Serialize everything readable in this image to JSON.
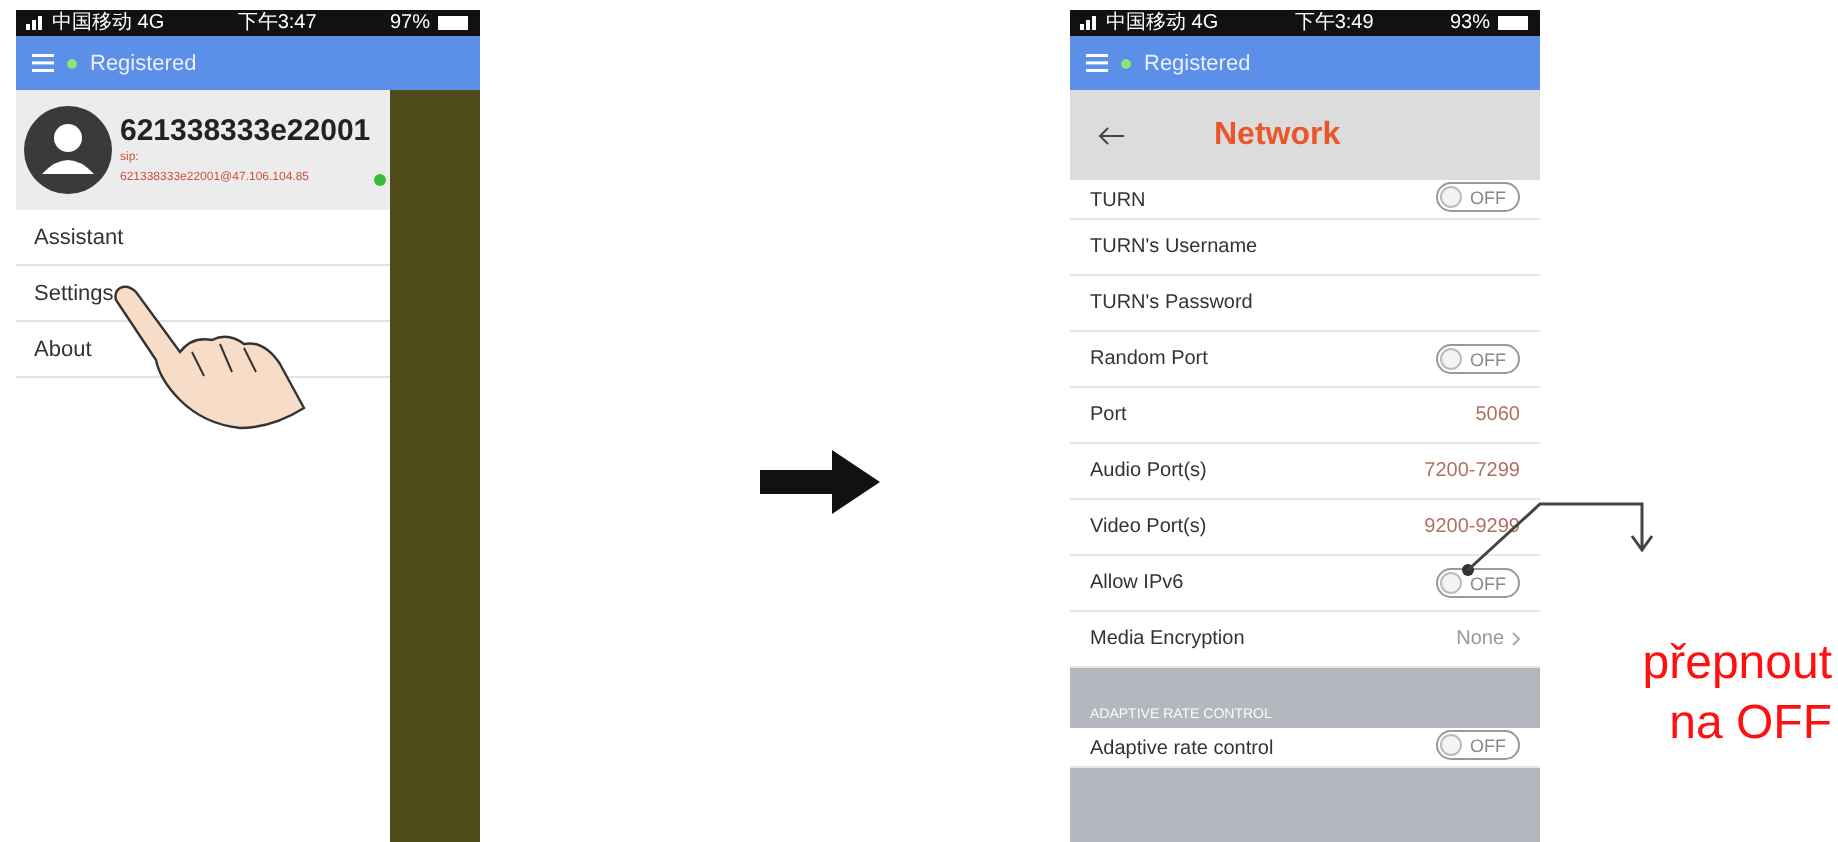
{
  "left_phone": {
    "status_bar": {
      "carrier": "中国移动 4G",
      "time": "下午3:47",
      "battery": "97%"
    },
    "header": {
      "status": "Registered"
    },
    "profile": {
      "name": "621338333e22001",
      "sip_label": "sip:",
      "address": "621338333e22001@47.106.104.85"
    },
    "menu": [
      {
        "label": "Assistant"
      },
      {
        "label": "Settings"
      },
      {
        "label": "About"
      }
    ]
  },
  "right_phone": {
    "status_bar": {
      "carrier": "中国移动 4G",
      "time": "下午3:49",
      "battery": "93%"
    },
    "header": {
      "status": "Registered"
    },
    "title": "Network",
    "rows": [
      {
        "kind": "toggle",
        "label": "TURN",
        "value": "OFF",
        "on": false
      },
      {
        "kind": "field",
        "label": "TURN's Username"
      },
      {
        "kind": "field",
        "label": "TURN's Password"
      },
      {
        "kind": "toggle",
        "label": "Random Port",
        "value": "OFF",
        "on": false
      },
      {
        "kind": "value",
        "label": "Port",
        "value": "5060"
      },
      {
        "kind": "value",
        "label": "Audio Port(s)",
        "value": "7200-7299"
      },
      {
        "kind": "value",
        "label": "Video Port(s)",
        "value": "9200-9299"
      },
      {
        "kind": "toggle",
        "label": "Allow IPv6",
        "value": "OFF",
        "on": false
      },
      {
        "kind": "select",
        "label": "Media Encryption",
        "value": "None"
      }
    ],
    "section_header": "ADAPTIVE RATE CONTROL",
    "section_rows": [
      {
        "kind": "toggle",
        "label": "Adaptive rate control",
        "value": "OFF",
        "on": false
      }
    ]
  },
  "annotation": {
    "text": "přepnout na OFF"
  }
}
